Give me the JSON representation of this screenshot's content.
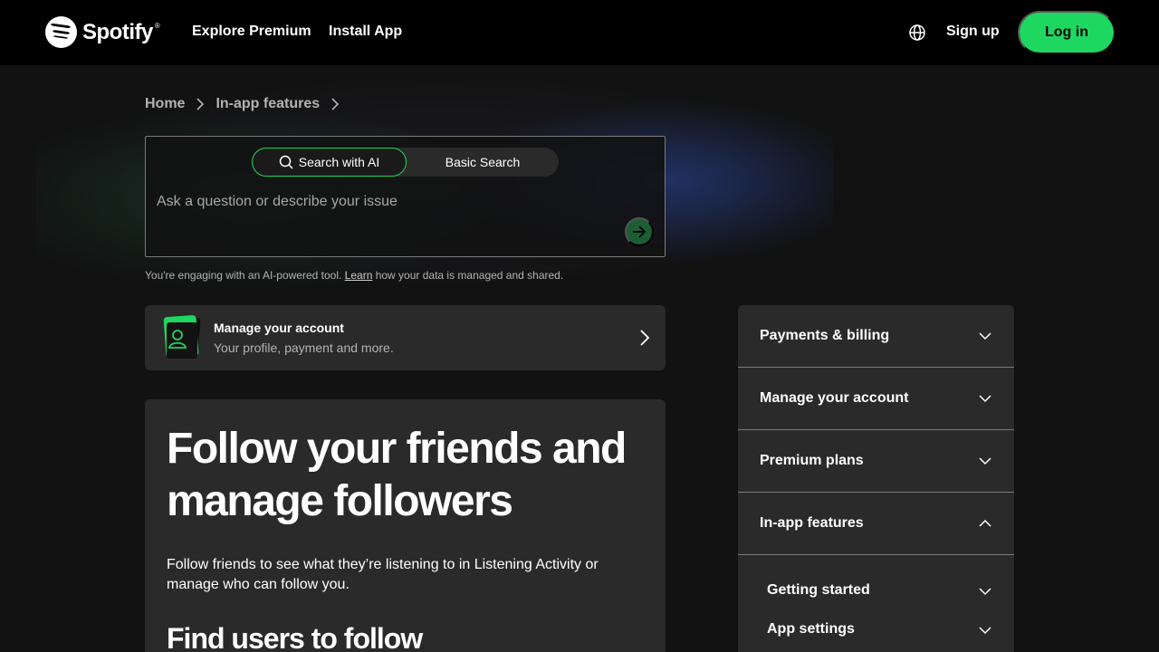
{
  "header": {
    "logo_text": "Spotify",
    "logo_reg": "®",
    "nav": [
      "Explore Premium",
      "Install App"
    ],
    "signup_label": "Sign up",
    "login_label": "Log in",
    "brand_color": "#1ed760"
  },
  "breadcrumb": [
    "Home",
    "In-app features"
  ],
  "search": {
    "ai_tab": "Search with AI",
    "basic_tab": "Basic Search",
    "placeholder": "Ask a question or describe your issue",
    "disclaimer_before": "You're engaging with an AI-powered tool. ",
    "disclaimer_link": "Learn",
    "disclaimer_after": " how your data is managed and shared."
  },
  "account_card": {
    "title": "Manage your account",
    "subtitle": "Your profile, payment and more."
  },
  "article": {
    "title": "Follow your friends and manage followers",
    "intro": "Follow friends to see what they’re listening to in Listening Activity or manage who can follow you.",
    "section_heading": "Find users to follow"
  },
  "sidebar": {
    "items": [
      {
        "label": "Payments & billing",
        "expanded": false
      },
      {
        "label": "Manage your account",
        "expanded": false
      },
      {
        "label": "Premium plans",
        "expanded": false
      },
      {
        "label": "In-app features",
        "expanded": true
      }
    ],
    "sub_items": [
      {
        "label": "Getting started"
      },
      {
        "label": "App settings"
      }
    ]
  }
}
